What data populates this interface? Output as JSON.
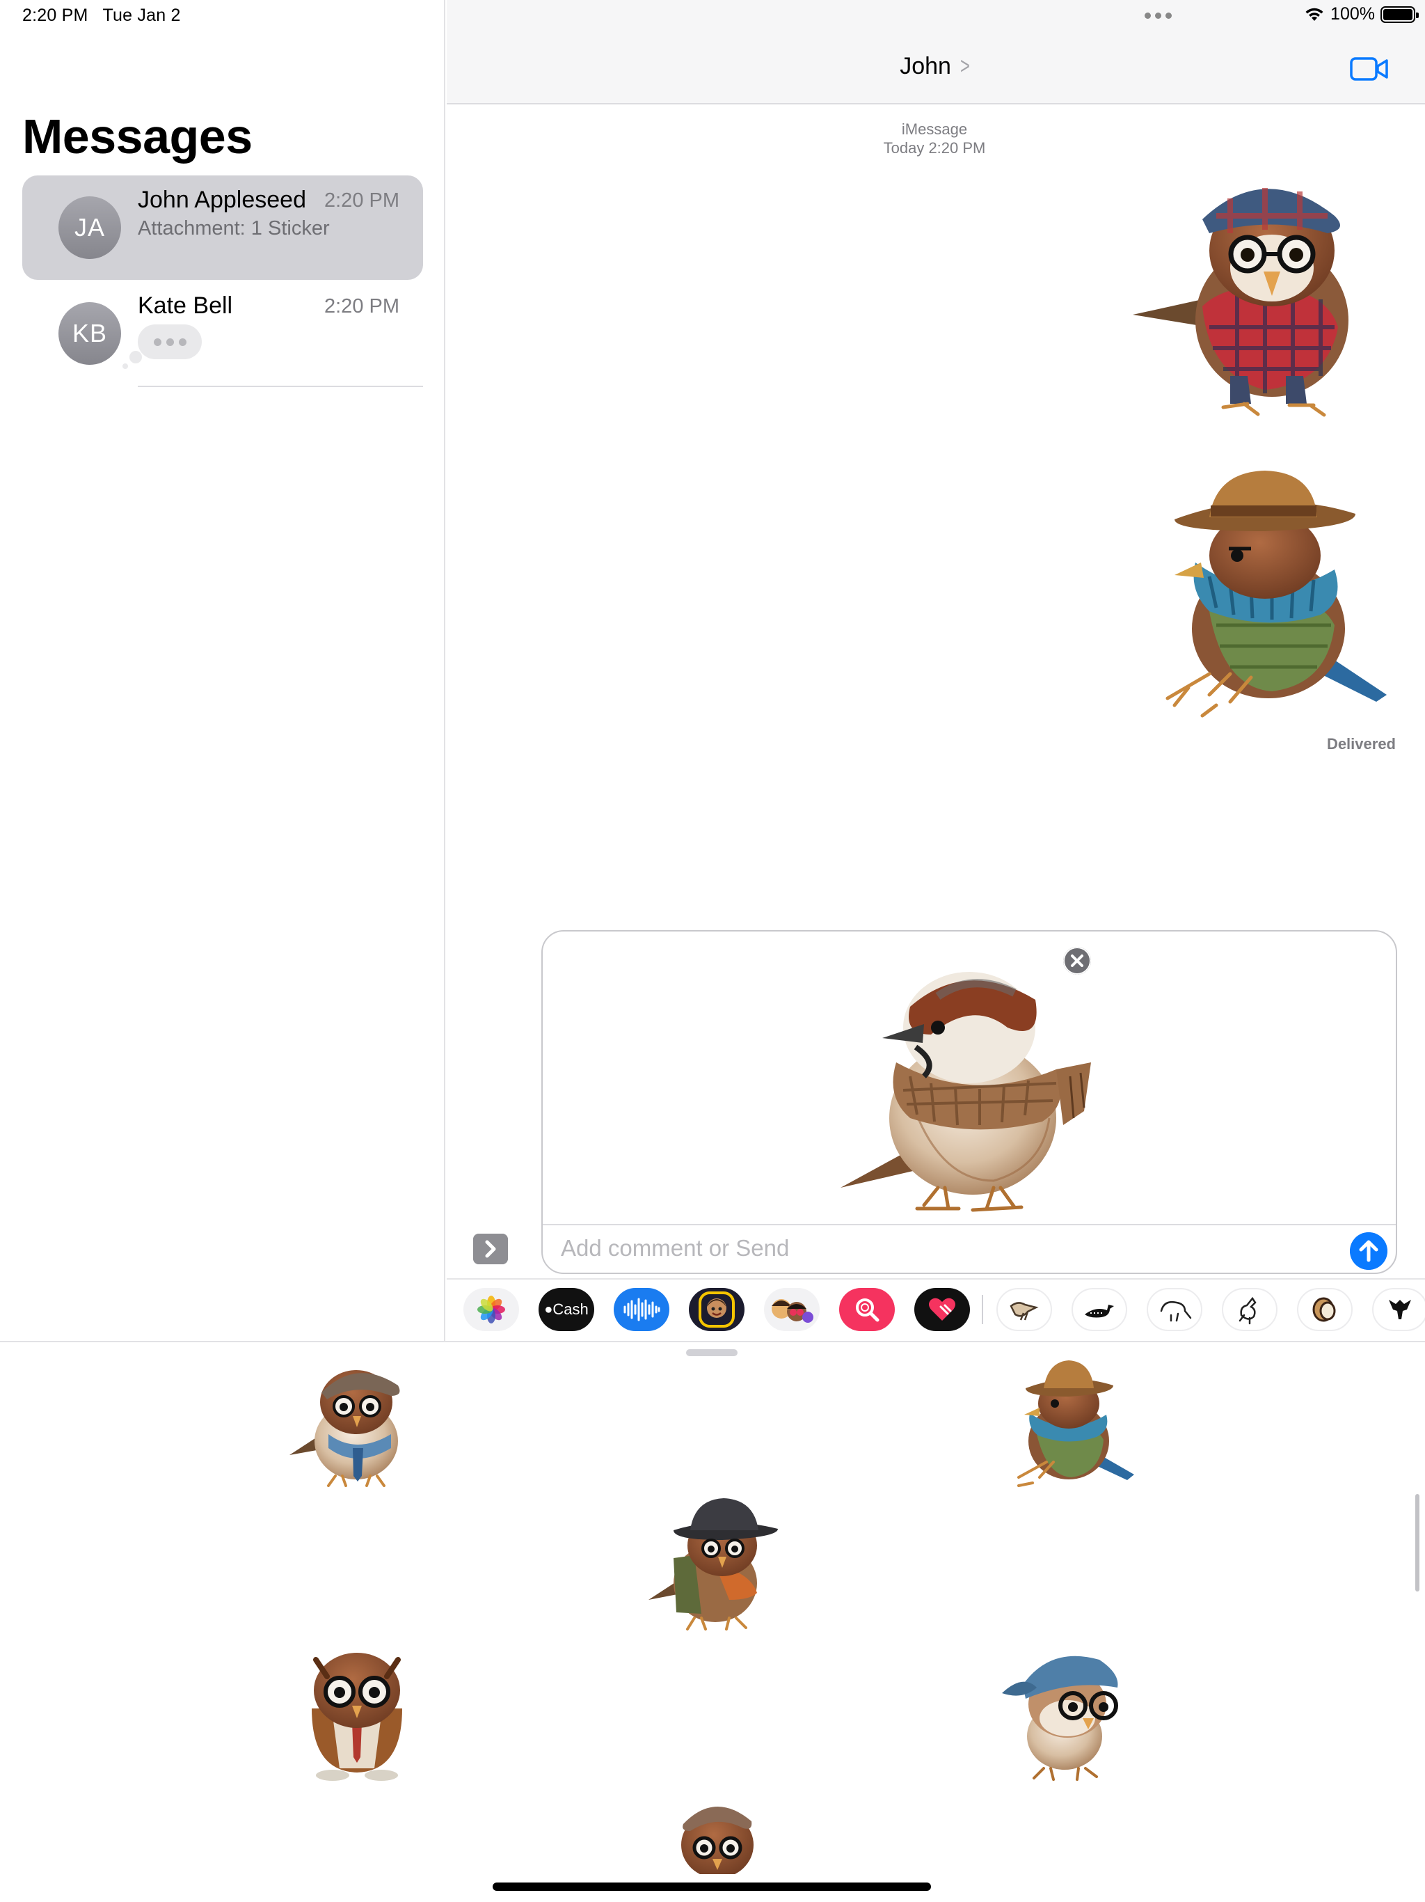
{
  "status_bar": {
    "time": "2:20 PM",
    "date": "Tue Jan 2",
    "battery": "100%"
  },
  "sidebar": {
    "title": "Messages",
    "conversations": [
      {
        "initials": "JA",
        "name": "John Appleseed",
        "time": "2:20 PM",
        "preview": "Attachment: 1 Sticker",
        "selected": true
      },
      {
        "initials": "KB",
        "name": "Kate Bell",
        "time": "2:20 PM",
        "preview": "",
        "typing": true
      }
    ]
  },
  "chat": {
    "contact_name": "John",
    "service": "iMessage",
    "timestamp": "Today 2:20 PM",
    "delivered": "Delivered",
    "messages": [
      {
        "kind": "sticker",
        "description": "sparrow-plaid-cap-hoodie"
      },
      {
        "kind": "sticker",
        "description": "sparrow-fedora-scarf-vest"
      }
    ]
  },
  "composer": {
    "placeholder": "Add comment or Send",
    "attachment": "sparrow-scarf-sticker"
  },
  "app_strip": {
    "items": [
      "photos-icon",
      "cash-icon",
      "audio-icon",
      "memoji-icon",
      "memoji-stickers-icon",
      "images-search-icon",
      "digital-touch-icon",
      "sparrow-app-icon",
      "loon-app-icon",
      "kiwi-app-icon",
      "bird-app-icon",
      "coconut-app-icon",
      "more-app-icon"
    ],
    "cash_label": "Cash"
  },
  "sticker_drawer": {
    "stickers": [
      "sparrow-cap-tie",
      "sparrow-bucket-hat-scarf",
      "sparrow-hat-backpack",
      "sparrow-owl-glasses-tie",
      "sparrow-blue-cap-glasses",
      "sparrow-beret-glasses"
    ]
  },
  "colors": {
    "accent": "#0A7AFF",
    "selected_row": "#D1D1D6",
    "avatar": "#9A9AA0"
  }
}
